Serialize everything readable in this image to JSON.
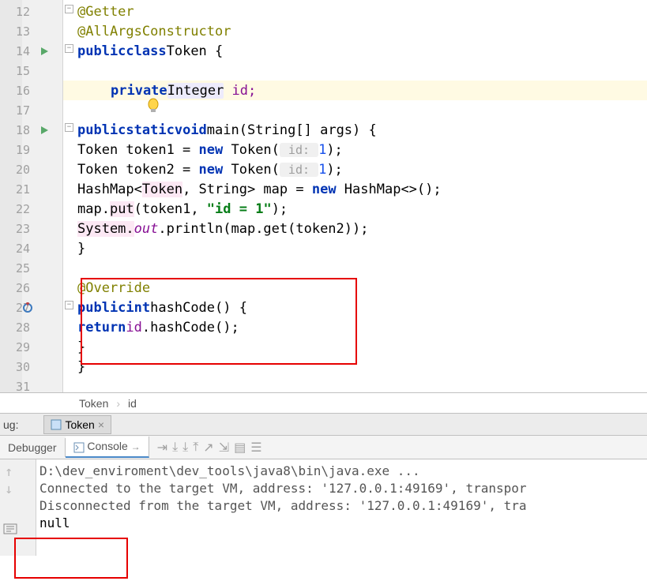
{
  "gutter": {
    "lines": [
      12,
      13,
      14,
      15,
      16,
      17,
      18,
      19,
      20,
      21,
      22,
      23,
      24,
      25,
      26,
      27,
      28,
      29,
      30,
      31
    ]
  },
  "code": {
    "l12_ann": "@Getter",
    "l13_ann": "@AllArgsConstructor",
    "l14_kw1": "public",
    "l14_kw2": "class",
    "l14_name": "Token",
    "l14_brace": " {",
    "l16_kw": "private",
    "l16_type": "Integer",
    "l16_id": " id;",
    "l18_kw1": "public",
    "l18_kw2": "static",
    "l18_kw3": "void",
    "l18_name": "main",
    "l18_sig": "(String[] args) {",
    "l19_a": "Token token1 = ",
    "l19_kw": "new",
    "l19_b": " Token(",
    "l19_hint": " id: ",
    "l19_num": "1",
    "l19_c": ");",
    "l20_a": "Token token2 = ",
    "l20_kw": "new",
    "l20_b": " Token(",
    "l20_hint": " id: ",
    "l20_num": "1",
    "l20_c": ");",
    "l21_a": "HashMap<",
    "l21_t": "Token",
    "l21_b": ", String> map = ",
    "l21_kw": "new",
    "l21_c": " HashMap<>();",
    "l22_a": "map.",
    "l22_m": "put",
    "l22_b": "(token1, ",
    "l22_s": "\"id = 1\"",
    "l22_c": ");",
    "l23_a": "System.",
    "l23_f": "out",
    "l23_b": ".println(map.get(token2));",
    "l24": "}",
    "l26_ann": "@Override",
    "l27_kw1": "public",
    "l27_kw2": "int",
    "l27_name": "hashCode",
    "l27_sig": "() {",
    "l28_kw": "return",
    "l28_id": "id",
    "l28_b": ".hashCode();",
    "l29": "}",
    "l30": "}"
  },
  "breadcrumb": {
    "class": "Token",
    "sep": "›",
    "field": "id"
  },
  "tabs": {
    "debug_label": "ug:",
    "file_tab": "Token",
    "tab_close": "×"
  },
  "toolbar": {
    "debugger": "Debugger",
    "console": "Console",
    "arrow": "→"
  },
  "console": {
    "line1": "D:\\dev_enviroment\\dev_tools\\java8\\bin\\java.exe ...",
    "line2": "Connected to the target VM, address: '127.0.0.1:49169', transpor",
    "line3": "Disconnected from the target VM, address: '127.0.0.1:49169', tra",
    "line4": "null"
  }
}
